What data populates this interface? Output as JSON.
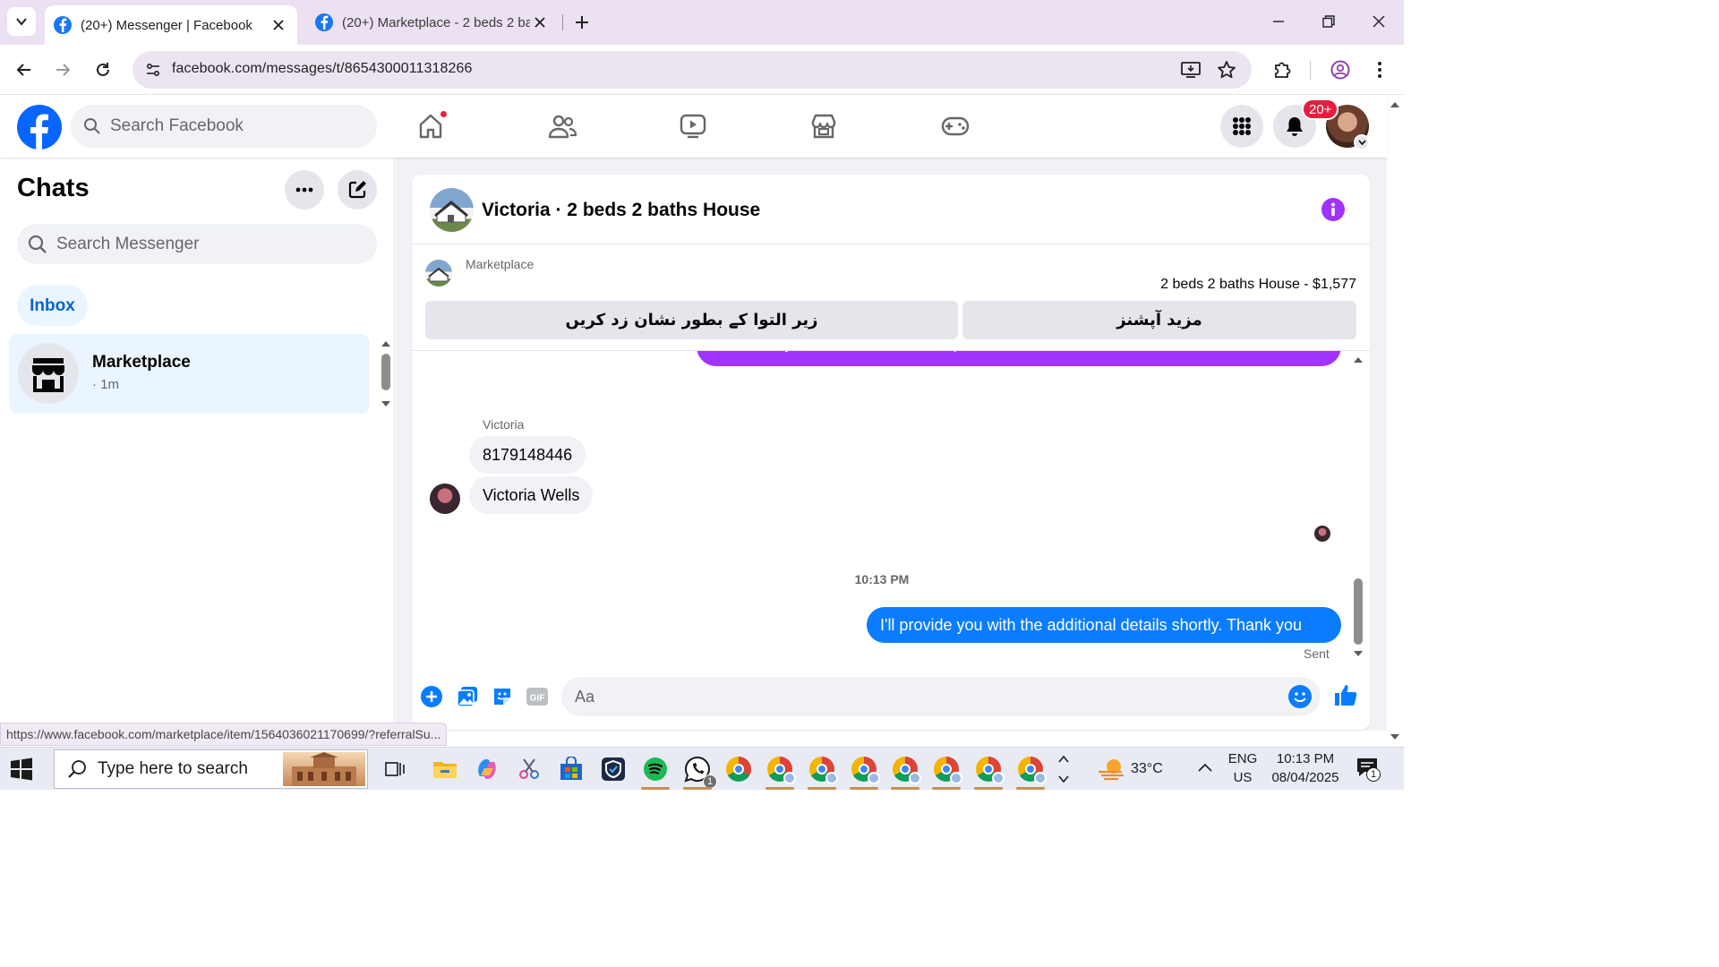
{
  "browser": {
    "tabs": [
      {
        "title": "(20+) Messenger | Facebook",
        "active": true
      },
      {
        "title": "(20+) Marketplace - 2 beds 2 ba",
        "active": false
      }
    ],
    "url": "facebook.com/messages/t/8654300011318266"
  },
  "fb": {
    "search_placeholder": "Search Facebook",
    "notification_count": "20+"
  },
  "chats": {
    "title": "Chats",
    "search_placeholder": "Search Messenger",
    "filter_label": "Inbox",
    "items": [
      {
        "name": "Marketplace",
        "time": "· 1m"
      }
    ]
  },
  "conversation": {
    "title": "Victoria · 2 beds 2 baths House",
    "marketplace_label": "Marketplace",
    "listing": "2 beds 2 baths House - $1,577",
    "btn_mark_pending": "زیر التوا کے بطور نشان زد کریں",
    "btn_more_options": "مزید آپشنز",
    "partial_message": "can send you details and the requirements about the house",
    "sender_name": "Victoria",
    "incoming": [
      {
        "text": "8179148446"
      },
      {
        "text": "Victoria Wells"
      }
    ],
    "timestamp": "10:13 PM",
    "outgoing": "I'll provide you with the additional details shortly. Thank you",
    "status": "Sent",
    "composer_placeholder": "Aa"
  },
  "status_url": "https://www.facebook.com/marketplace/item/1564036021170699/?referralSu...",
  "taskbar": {
    "search_placeholder": "Type here to search",
    "weather": "33°C",
    "lang_1": "ENG",
    "lang_2": "US",
    "time": "10:13 PM",
    "date": "08/04/2025",
    "whatsapp_badge": "1",
    "notification_badge": "1"
  },
  "colors": {
    "fb_blue": "#0866ff",
    "messenger_blue": "#0a7cff",
    "purple": "#a033ff",
    "chrome_tabbar": "#ece1f2"
  }
}
